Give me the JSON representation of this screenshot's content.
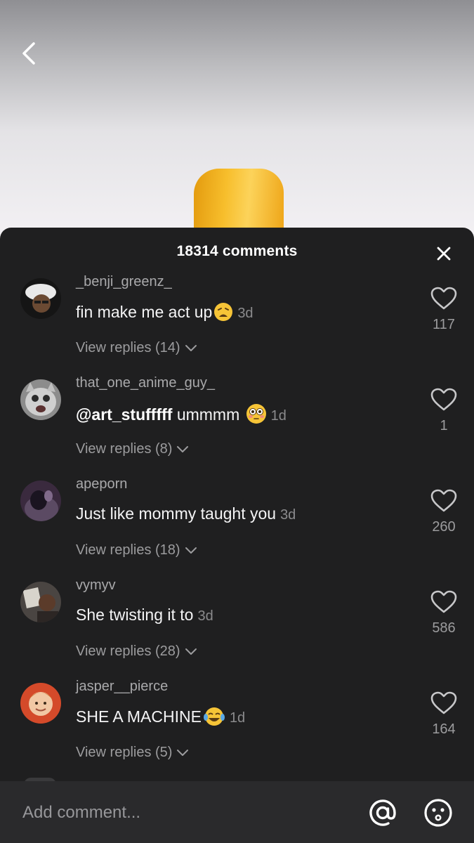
{
  "header": {
    "comment_count": "18314 comments"
  },
  "comments": [
    {
      "username": "_benji_greenz_",
      "text": "fin make me act up",
      "mention": "",
      "emoji": "weary-face",
      "time": "3d",
      "replies": "View replies (14)",
      "likes": "117"
    },
    {
      "username": "that_one_anime_guy_",
      "text": "ummmm",
      "mention": "@art_stufffff",
      "emoji": "flushed-face",
      "time": "1d",
      "replies": "View replies (8)",
      "likes": "1"
    },
    {
      "username": "apeporn",
      "text": "Just like mommy taught you",
      "mention": "",
      "emoji": "",
      "time": "3d",
      "replies": "View replies (18)",
      "likes": "260"
    },
    {
      "username": "vymyv",
      "text": "She twisting it to",
      "mention": "",
      "emoji": "",
      "time": "3d",
      "replies": "View replies (28)",
      "likes": "586"
    },
    {
      "username": "jasper__pierce",
      "text": "SHE A MACHINE",
      "mention": "",
      "emoji": "tears-of-joy-face",
      "time": "1d",
      "replies": "View replies (5)",
      "likes": "164"
    }
  ],
  "composer": {
    "placeholder": "Add comment..."
  },
  "icons": {
    "back": "chevron-left-icon",
    "close": "close-icon",
    "like": "heart-outline-icon",
    "replies_toggle": "chevron-down-icon",
    "mention": "at-sign-icon",
    "emoji_picker": "smiley-face-icon"
  },
  "colors": {
    "sheet_bg": "#1f1f20",
    "composer_bg": "#2a2a2c",
    "text_primary": "#f4f4f5",
    "text_secondary": "#9c9c9e"
  }
}
